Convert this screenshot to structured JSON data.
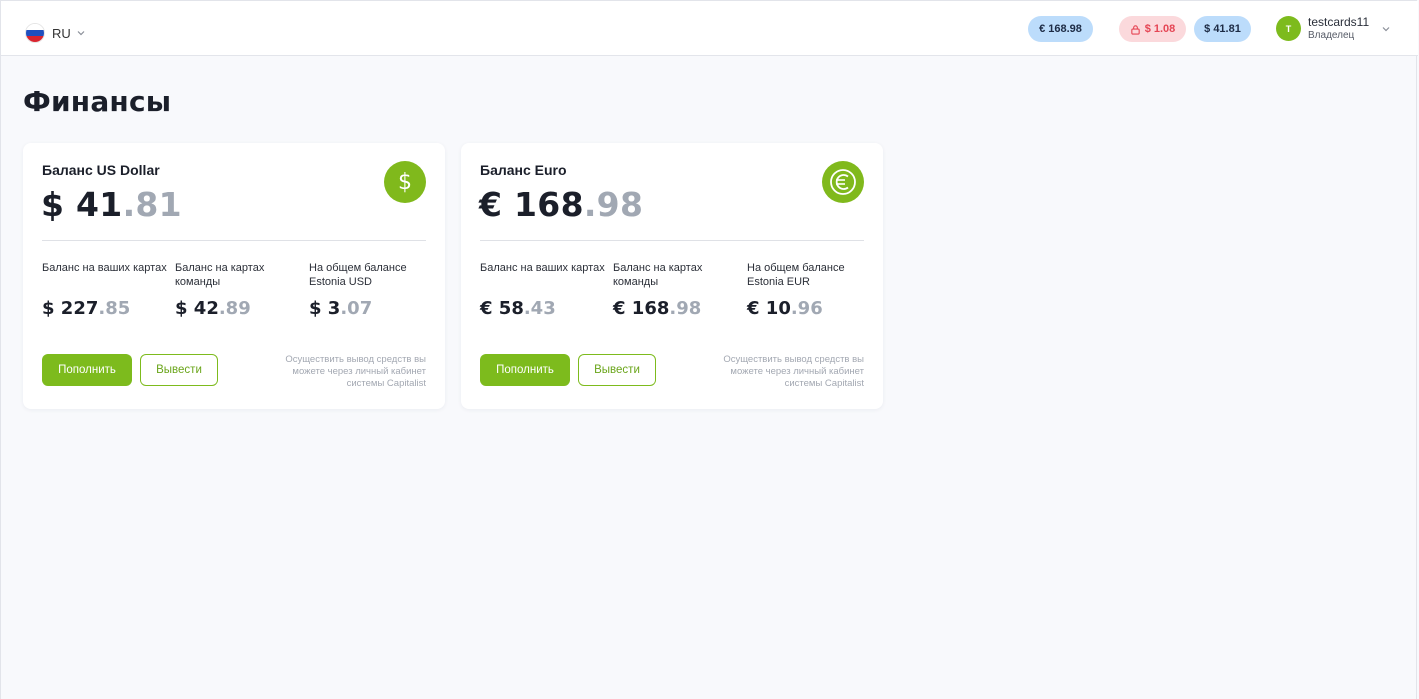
{
  "header": {
    "language": {
      "code": "RU"
    },
    "balances": {
      "eur": "€ 168.98",
      "locked": "$ 1.08",
      "usd": "$ 41.81"
    },
    "user": {
      "avatar_letter": "T",
      "name": "testcards11",
      "role": "Владелец"
    }
  },
  "page": {
    "title": "Финансы"
  },
  "cards": [
    {
      "title": "Баланс US Dollar",
      "amount_main": "$ 41",
      "amount_cents": ".81",
      "icon": "dollar-icon",
      "subs": [
        {
          "label": "Баланс на ваших картах",
          "main": "$ 227",
          "cents": ".85"
        },
        {
          "label": "Баланс на картах команды",
          "main": "$ 42",
          "cents": ".89"
        },
        {
          "label": "На общем балансе Estonia USD",
          "main": "$ 3",
          "cents": ".07"
        }
      ],
      "deposit_label": "Пополнить",
      "withdraw_label": "Вывести",
      "hint": "Осуществить вывод средств вы можете через личный кабинет системы Capitalist"
    },
    {
      "title": "Баланс Euro",
      "amount_main": "€ 168",
      "amount_cents": ".98",
      "icon": "euro-icon",
      "subs": [
        {
          "label": "Баланс на ваших картах",
          "main": "€ 58",
          "cents": ".43"
        },
        {
          "label": "Баланс на картах команды",
          "main": "€ 168",
          "cents": ".98"
        },
        {
          "label": "На общем балансе Estonia EUR",
          "main": "€ 10",
          "cents": ".96"
        }
      ],
      "deposit_label": "Пополнить",
      "withdraw_label": "Вывести",
      "hint": "Осуществить вывод средств вы можете через личный кабинет системы Capitalist"
    }
  ],
  "colors": {
    "accent": "#7dbb1d",
    "pill_blue": "#bcdcfb",
    "pill_red": "#fbd9dc",
    "cents_gray": "#a1a8b3"
  }
}
